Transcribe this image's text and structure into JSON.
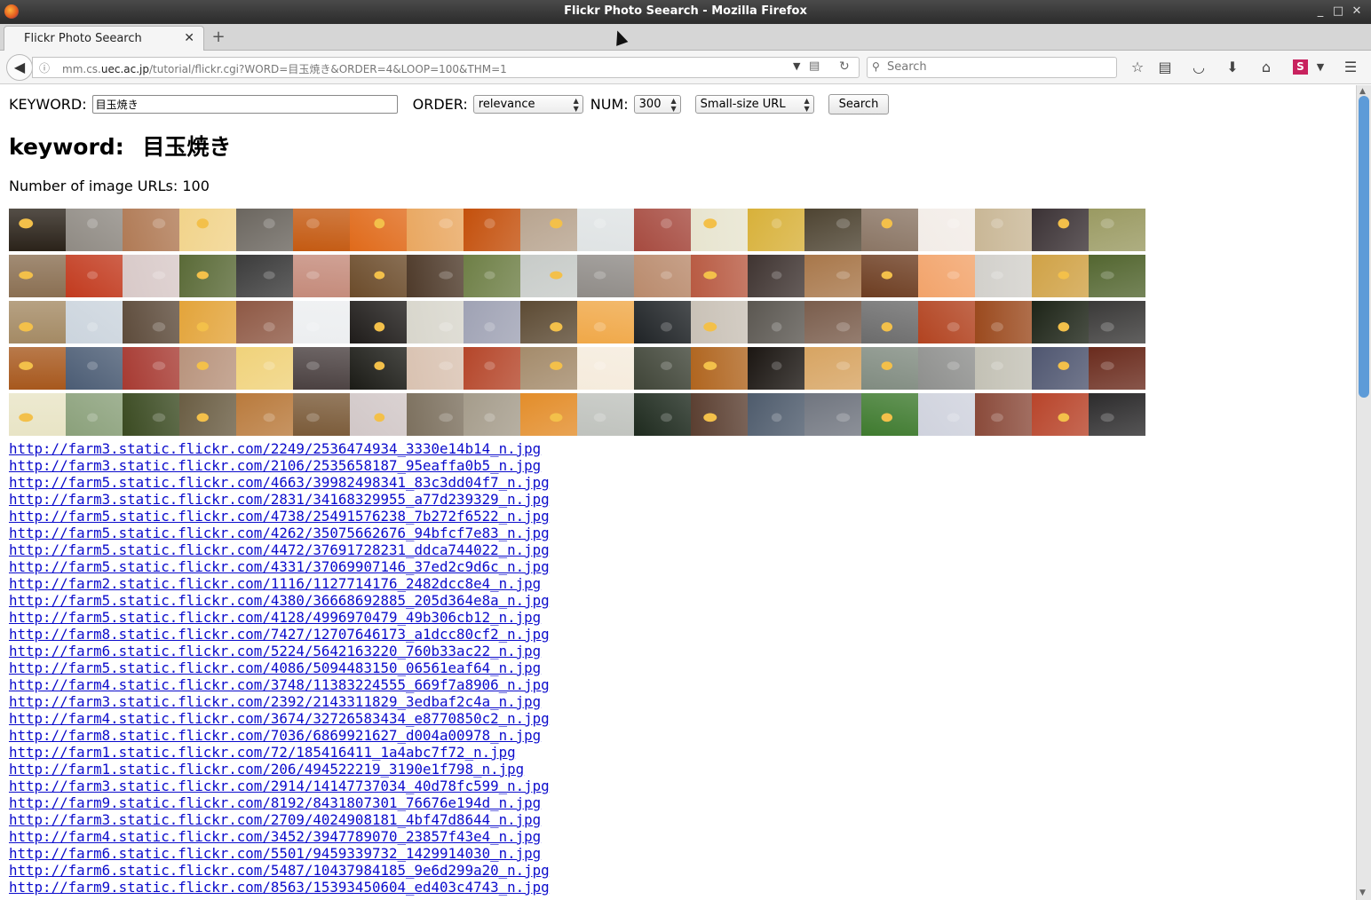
{
  "window": {
    "title": "Flickr Photo Seearch - Mozilla Firefox"
  },
  "tab": {
    "label": "Flickr Photo Seearch"
  },
  "urlbar": {
    "prefix": "mm.cs.",
    "host": "uec.ac.jp",
    "path": "/tutorial/flickr.cgi?WORD=目玉焼き&ORDER=4&LOOP=100&THM=1"
  },
  "searchbar": {
    "placeholder": "Search"
  },
  "form": {
    "keyword_label": "KEYWORD:",
    "keyword_value": "目玉焼き",
    "order_label": "ORDER:",
    "order_value": "relevance",
    "num_label": "NUM:",
    "num_value": "300",
    "thumb_value": "Small-size URL",
    "search_button": "Search"
  },
  "heading": {
    "label": "keyword:",
    "keyword": "目玉焼き"
  },
  "count": {
    "label": "Number of image URLs:",
    "value": "100"
  },
  "thumbnail_palette": [
    [
      "#2a2219",
      "#8f8a83",
      "#b07a55",
      "#f1d38a",
      "#6b665f",
      "#c45a12",
      "#e06a1a",
      "#e9a760",
      "#c4500c",
      "#b8a48f",
      "#dfe3e4",
      "#a64a3f",
      "#e7e4cf",
      "#d8b13a",
      "#4e4432",
      "#8a7564",
      "#f2ece7",
      "#c9b796",
      "#3b3235",
      "#9a9a62"
    ],
    [
      "#8a6f52",
      "#c23a1e",
      "#d8c9c8",
      "#5a6a37",
      "#3b3b3b",
      "#c48a7a",
      "#6b4b2a",
      "#4e3a2a",
      "#6e7f46",
      "#c7cbc8",
      "#8f8b87",
      "#b98a6c",
      "#b85a42",
      "#3f3431",
      "#a8774a",
      "#6d3d21",
      "#f2a36a",
      "#d2d0cb",
      "#d0a246",
      "#536630"
    ],
    [
      "#a48a64",
      "#cbd4dd",
      "#5d4b3b",
      "#e3a43a",
      "#8e5844",
      "#eceef0",
      "#1f1c1a",
      "#d8d6cc",
      "#9fa2b4",
      "#5c4a33",
      "#f0a848",
      "#1f2326",
      "#c9c1b6",
      "#5b5751",
      "#7a5d4c",
      "#6b6b6b",
      "#b24320",
      "#9b4a1e",
      "#1d2417",
      "#3a3938"
    ],
    [
      "#a7581d",
      "#4b5c74",
      "#a73a32",
      "#b8937c",
      "#f0d27a",
      "#4a4040",
      "#1b1b16",
      "#d9c2b1",
      "#b5462a",
      "#a48b6b",
      "#f5ebdc",
      "#3f4437",
      "#b0651f",
      "#1b1612",
      "#d7a462",
      "#808b80",
      "#8e8f8d",
      "#c3c1b5",
      "#4f5670",
      "#6a2b1d"
    ],
    [
      "#e8e4c5",
      "#8aa07a",
      "#3a4a21",
      "#6a5d43",
      "#b97a3c",
      "#7a5a38",
      "#d1c7c7",
      "#7c705e",
      "#a59c8b",
      "#e38d2a",
      "#bfc2bd",
      "#1e2a1e",
      "#5a3e30",
      "#4e5b6c",
      "#70757f",
      "#3e7a2e",
      "#cfd2dd",
      "#8a4a3a",
      "#b8442a",
      "#2c2b2c"
    ]
  ],
  "thumbnail_extra_last_row": [
    "#c7a1a8",
    "#9a7a60"
  ],
  "links": [
    "http://farm3.static.flickr.com/2249/2536474934_3330e14b14_n.jpg",
    "http://farm3.static.flickr.com/2106/2535658187_95eaffa0b5_n.jpg",
    "http://farm5.static.flickr.com/4663/39982498341_83c3dd04f7_n.jpg",
    "http://farm3.static.flickr.com/2831/34168329955_a77d239329_n.jpg",
    "http://farm5.static.flickr.com/4738/25491576238_7b272f6522_n.jpg",
    "http://farm5.static.flickr.com/4262/35075662676_94bfcf7e83_n.jpg",
    "http://farm5.static.flickr.com/4472/37691728231_ddca744022_n.jpg",
    "http://farm5.static.flickr.com/4331/37069907146_37ed2c9d6c_n.jpg",
    "http://farm2.static.flickr.com/1116/1127714176_2482dcc8e4_n.jpg",
    "http://farm5.static.flickr.com/4380/36668692885_205d364e8a_n.jpg",
    "http://farm5.static.flickr.com/4128/4996970479_49b306cb12_n.jpg",
    "http://farm8.static.flickr.com/7427/12707646173_a1dcc80cf2_n.jpg",
    "http://farm6.static.flickr.com/5224/5642163220_760b33ac22_n.jpg",
    "http://farm5.static.flickr.com/4086/5094483150_06561eaf64_n.jpg",
    "http://farm4.static.flickr.com/3748/11383224555_669f7a8906_n.jpg",
    "http://farm3.static.flickr.com/2392/2143311829_3edbaf2c4a_n.jpg",
    "http://farm4.static.flickr.com/3674/32726583434_e8770850c2_n.jpg",
    "http://farm8.static.flickr.com/7036/6869921627_d004a00978_n.jpg",
    "http://farm1.static.flickr.com/72/185416411_1a4abc7f72_n.jpg",
    "http://farm1.static.flickr.com/206/494522219_3190e1f798_n.jpg",
    "http://farm3.static.flickr.com/2914/14147737034_40d78fc599_n.jpg",
    "http://farm9.static.flickr.com/8192/8431807301_76676e194d_n.jpg",
    "http://farm3.static.flickr.com/2709/4024908181_4bf47d8644_n.jpg",
    "http://farm4.static.flickr.com/3452/3947789070_23857f43e4_n.jpg",
    "http://farm6.static.flickr.com/5501/9459339732_1429914030_n.jpg",
    "http://farm6.static.flickr.com/5487/10437984185_9e6d299a20_n.jpg",
    "http://farm9.static.flickr.com/8563/15393450604_ed403c4743_n.jpg"
  ]
}
